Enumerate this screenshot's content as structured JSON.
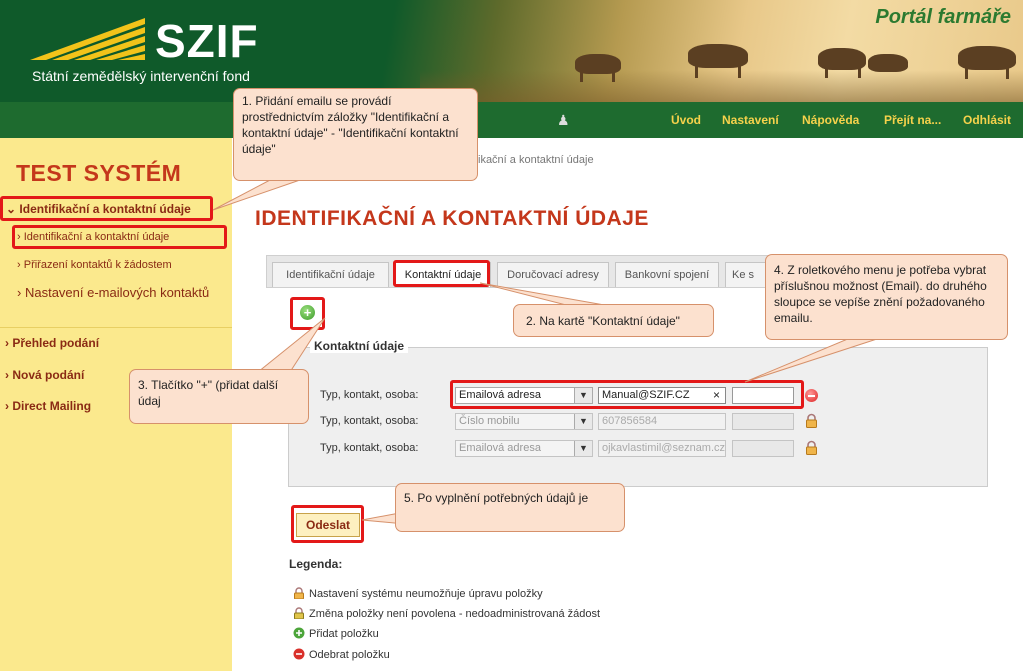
{
  "header": {
    "logo_text": "SZIF",
    "logo_subtitle": "Státní zemědělský intervenční fond",
    "portal_title": "Portál farmáře"
  },
  "nav": {
    "items": [
      {
        "label": "Úvod"
      },
      {
        "label": "Nastavení"
      },
      {
        "label": "Nápověda"
      },
      {
        "label": "Přejít na..."
      },
      {
        "label": "Odhlásit"
      }
    ]
  },
  "sidebar": {
    "title": "TEST SYSTÉM",
    "sections": [
      {
        "label": "Identifikační a kontaktní údaje"
      },
      {
        "label": "Identifikační a kontaktní údaje"
      },
      {
        "label": "Přiřazení kontaktů k žádostem"
      },
      {
        "label": "Nastavení e-mailových kontaktů"
      },
      {
        "label": "Přehled podání"
      },
      {
        "label": "Nová podání"
      },
      {
        "label": "Direct Mailing"
      }
    ]
  },
  "main": {
    "breadcrumb": "ikační a kontaktní údaje",
    "page_title": "IDENTIFIKAČNÍ A KONTAKTNÍ ÚDAJE",
    "tabs": [
      {
        "label": "Identifikační údaje"
      },
      {
        "label": "Kontaktní údaje"
      },
      {
        "label": "Doručovací adresy"
      },
      {
        "label": "Bankovní spojení"
      },
      {
        "label": "Ke s"
      }
    ],
    "fieldset_legend": "Kontaktní údaje",
    "rows": [
      {
        "label": "Typ, kontakt, osoba:",
        "type": "Emailová adresa",
        "value": "Manual@SZIF.CZ",
        "clear": "×"
      },
      {
        "label": "Typ, kontakt, osoba:",
        "type": "Číslo mobilu",
        "value": "607856584"
      },
      {
        "label": "Typ, kontakt, osoba:",
        "type": "Emailová adresa",
        "value": "ojkavlastimil@seznam.cz"
      }
    ],
    "submit_label": "Odeslat",
    "legend_title": "Legenda:",
    "legend_items": [
      {
        "label": "Nastavení systému neumožňuje úpravu položky"
      },
      {
        "label": "Změna položky není povolena - nedoadministrovaná žádost"
      },
      {
        "label": "Přidat položku"
      },
      {
        "label": "Odebrat položku"
      }
    ]
  },
  "callouts": {
    "c1": "1. Přidání emailu se provádí prostřednictvím záložky \"Identifikační a kontaktní údaje\" - \"Identifikační kontaktní údaje\"",
    "c2": "2. Na kartě \"Kontaktní údaje\"",
    "c3": "3. Tlačítko \"+\" (přidat další údaj",
    "c4": "4. Z roletkového menu je potřeba vybrat příslušnou možnost (Email). do druhého sloupce se vepíše znění požadovaného emailu.",
    "c5": "5. Po vyplnění potřebných údajů je"
  },
  "colors": {
    "header_green": "#1e6b2f",
    "accent_red": "#c4371b",
    "sidebar_yellow": "#fbe98d",
    "highlight_red": "#e31818",
    "callout_fill": "#fce1cf"
  }
}
